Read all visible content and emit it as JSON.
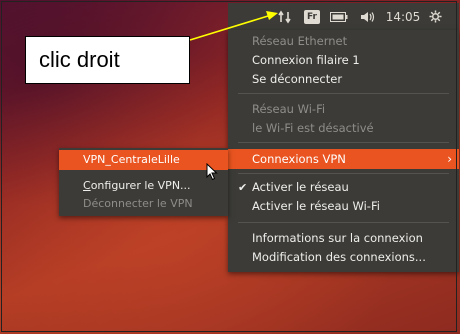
{
  "callout": {
    "text": "clic droit"
  },
  "topbar": {
    "keyboard_label": "Fr",
    "clock": "14:05",
    "icons": [
      "network-updown-icon",
      "keyboard-layout-icon",
      "battery-icon",
      "volume-icon",
      "gear-icon"
    ]
  },
  "menu": {
    "ethernet_header": "Réseau Ethernet",
    "wired_connection": "Connexion filaire 1",
    "disconnect": "Se déconnecter",
    "wifi_header": "Réseau Wi-Fi",
    "wifi_disabled": "le Wi-Fi est désactivé",
    "vpn_connections": "Connexions VPN",
    "enable_network": "Activer le réseau",
    "enable_wifi": "Activer le réseau Wi-Fi",
    "connection_info": "Informations sur la connexion",
    "edit_connections": "Modification des connexions..."
  },
  "submenu": {
    "vpn_name": "VPN_CentraleLille",
    "configure_first": "C",
    "configure_rest": "onfigurer le VPN...",
    "disconnect_vpn": "Déconnecter le VPN"
  },
  "colors": {
    "accent": "#e95420",
    "panel": "#3c3b37",
    "disabled_text": "#8f8d89",
    "arrow": "#ffff00"
  }
}
